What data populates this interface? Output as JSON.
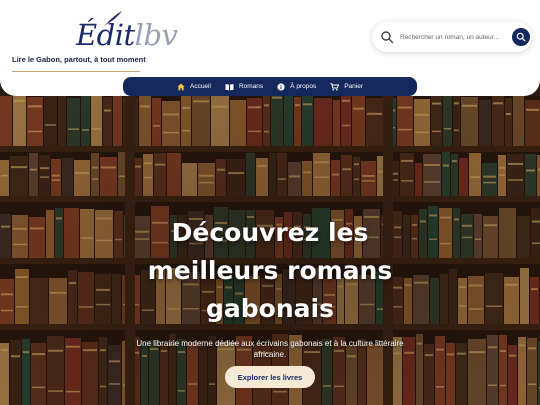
{
  "brand": {
    "logo_main": "Édit",
    "logo_accent": "lbv",
    "tagline": "Lire le Gabon, partout, à tout moment"
  },
  "search": {
    "placeholder": "Rechercher un roman, un auteur..."
  },
  "nav": {
    "items": [
      {
        "label": "Accueil",
        "icon": "home-icon"
      },
      {
        "label": "Romans",
        "icon": "book-icon"
      },
      {
        "label": "À propos",
        "icon": "info-icon"
      },
      {
        "label": "Panier",
        "icon": "cart-icon"
      }
    ]
  },
  "hero": {
    "title_line1": "Découvrez les",
    "title_line2": "meilleurs romans",
    "title_line3": "gabonais",
    "subtitle_line1": "Une librairie moderne dédiée aux écrivains gabonais et à la culture littéraire",
    "subtitle_line2": "africaine.",
    "cta": "Explorer les livres"
  },
  "colors": {
    "navy": "#14285e",
    "cream": "#f6ead7",
    "gold": "#c9a678"
  }
}
